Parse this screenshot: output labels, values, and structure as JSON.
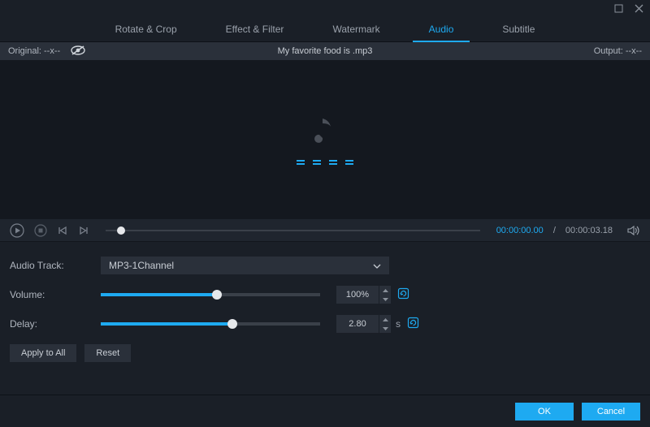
{
  "titlebar": {
    "minimize": "minimize",
    "close": "close"
  },
  "tabs": {
    "items": [
      "Rotate & Crop",
      "Effect & Filter",
      "Watermark",
      "Audio",
      "Subtitle"
    ],
    "active_index": 3
  },
  "infobar": {
    "original_label": "Original: --x--",
    "filename": "My favorite food is .mp3",
    "output_label": "Output: --x--"
  },
  "player": {
    "current_time": "00:00:00.00",
    "separator": "/",
    "total_time": "00:00:03.18"
  },
  "audio": {
    "track_label": "Audio Track:",
    "track_value": "MP3-1Channel",
    "volume_label": "Volume:",
    "volume_value": "100%",
    "volume_pct": 53,
    "delay_label": "Delay:",
    "delay_value": "2.80",
    "delay_unit": "s",
    "delay_pct": 60
  },
  "buttons": {
    "apply_all": "Apply to All",
    "reset": "Reset",
    "ok": "OK",
    "cancel": "Cancel"
  }
}
